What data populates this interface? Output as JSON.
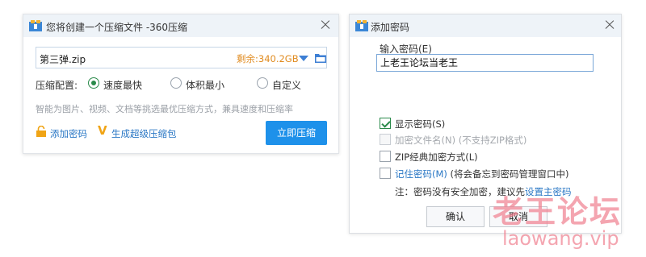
{
  "compress_dialog": {
    "title": "您将创建一个压缩文件 -360压缩",
    "file_name": "第三弹.zip",
    "remaining": "剩余:340.2GB",
    "option_label": "压缩配置:",
    "options": [
      {
        "label": "速度最快",
        "selected": true
      },
      {
        "label": "体积最小",
        "selected": false
      },
      {
        "label": "自定义",
        "selected": false
      }
    ],
    "hint": "智能为图片、视频、文档等挑选最优压缩方式，兼具速度和压缩率",
    "add_password": "添加密码",
    "super_zip": "生成超级压缩包",
    "compress_button": "立即压缩"
  },
  "password_dialog": {
    "title": "添加密码",
    "input_label": "输入密码(E)",
    "password_value": "上老王论坛当老王",
    "checkboxes": [
      {
        "label": "显示密码(S)",
        "checked": true,
        "disabled": false
      },
      {
        "label": "加密文件名(N) (不支持ZIP格式)",
        "checked": false,
        "disabled": true
      },
      {
        "label": "ZIP经典加密方式(L)",
        "checked": false,
        "disabled": false
      },
      {
        "label_link": "记住密码(M)",
        "label_rest": " (将会备忘到密码管理窗口中)",
        "checked": false,
        "disabled": false
      }
    ],
    "note_prefix": "注：密码没有安全加密，建议先",
    "note_link": "设置主密码",
    "ok_button": "确认",
    "cancel_button": "取消"
  },
  "watermark": {
    "cn": "老王论坛",
    "en": "laowang.vip"
  },
  "colors": {
    "accent_blue": "#1e91ea",
    "link_blue": "#2b78c5",
    "remaining_orange": "#e08a1e",
    "check_green": "#2a8a4a"
  }
}
